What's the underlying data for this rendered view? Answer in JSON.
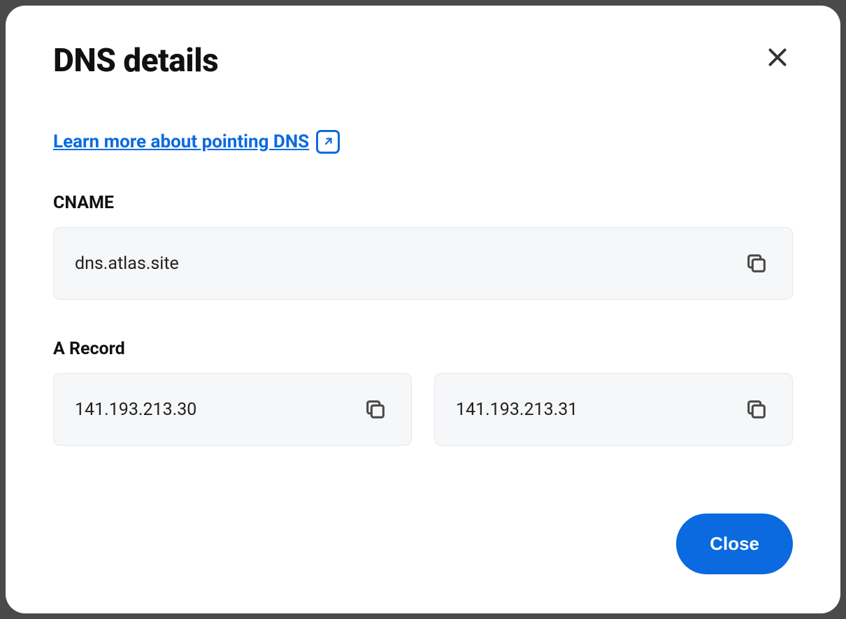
{
  "modal": {
    "title": "DNS details",
    "learn_link": "Learn more about pointing DNS",
    "cname_label": "CNAME",
    "cname_value": "dns.atlas.site",
    "arecord_label": "A Record",
    "arecords": [
      "141.193.213.30",
      "141.193.213.31"
    ],
    "close_button": "Close"
  }
}
